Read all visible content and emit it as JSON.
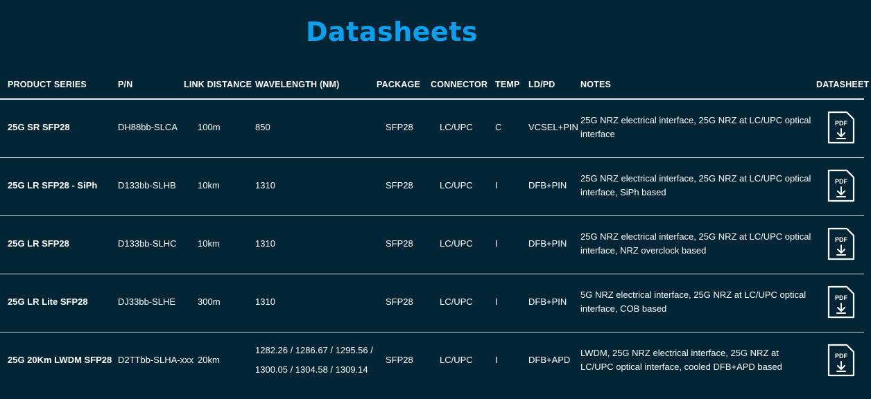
{
  "page": {
    "title": "Datasheets"
  },
  "table": {
    "headers": [
      "PRODUCT SERIES",
      "P/N",
      "LINK DISTANCE",
      "WAVELENGTH (NM)",
      "PACKAGE",
      "CONNECTOR",
      "TEMP",
      "LD/PD",
      "NOTES",
      "DATASHEET"
    ],
    "pdf_label": "PDF",
    "rows": [
      {
        "series": "25G SR SFP28",
        "pn": "DH88bb-SLCA",
        "distance": "100m",
        "wavelength": "850",
        "package": "SFP28",
        "connector": "LC/UPC",
        "temp": "C",
        "ldpd": "VCSEL+PIN",
        "notes": "25G NRZ electrical interface, 25G NRZ at LC/UPC optical interface"
      },
      {
        "series": "25G LR SFP28 - SiPh",
        "pn": "D133bb-SLHB",
        "distance": "10km",
        "wavelength": "1310",
        "package": "SFP28",
        "connector": "LC/UPC",
        "temp": "I",
        "ldpd": "DFB+PIN",
        "notes": "25G NRZ electrical interface, 25G NRZ at LC/UPC optical interface, SiPh based"
      },
      {
        "series": "25G LR SFP28",
        "pn": "D133bb-SLHC",
        "distance": "10km",
        "wavelength": "1310",
        "package": "SFP28",
        "connector": "LC/UPC",
        "temp": "I",
        "ldpd": "DFB+PIN",
        "notes": "25G NRZ electrical interface, 25G NRZ at LC/UPC optical interface, NRZ overclock based"
      },
      {
        "series": "25G LR Lite SFP28",
        "pn": "DJ33bb-SLHE",
        "distance": "300m",
        "wavelength": "1310",
        "package": "SFP28",
        "connector": "LC/UPC",
        "temp": "I",
        "ldpd": "DFB+PIN",
        "notes": "5G NRZ electrical interface, 25G NRZ at LC/UPC optical interface, COB based"
      },
      {
        "series": "25G 20Km LWDM SFP28",
        "pn": "D2TTbb-SLHA-xxx",
        "distance": "20km",
        "wavelength": "1282.26 / 1286.67 / 1295.56 / 1300.05 / 1304.58 / 1309.14",
        "package": "SFP28",
        "connector": "LC/UPC",
        "temp": "I",
        "ldpd": "DFB+APD",
        "notes": "LWDM, 25G NRZ electrical interface, 25G NRZ at LC/UPC optical interface, cooled DFB+APD based"
      }
    ]
  }
}
